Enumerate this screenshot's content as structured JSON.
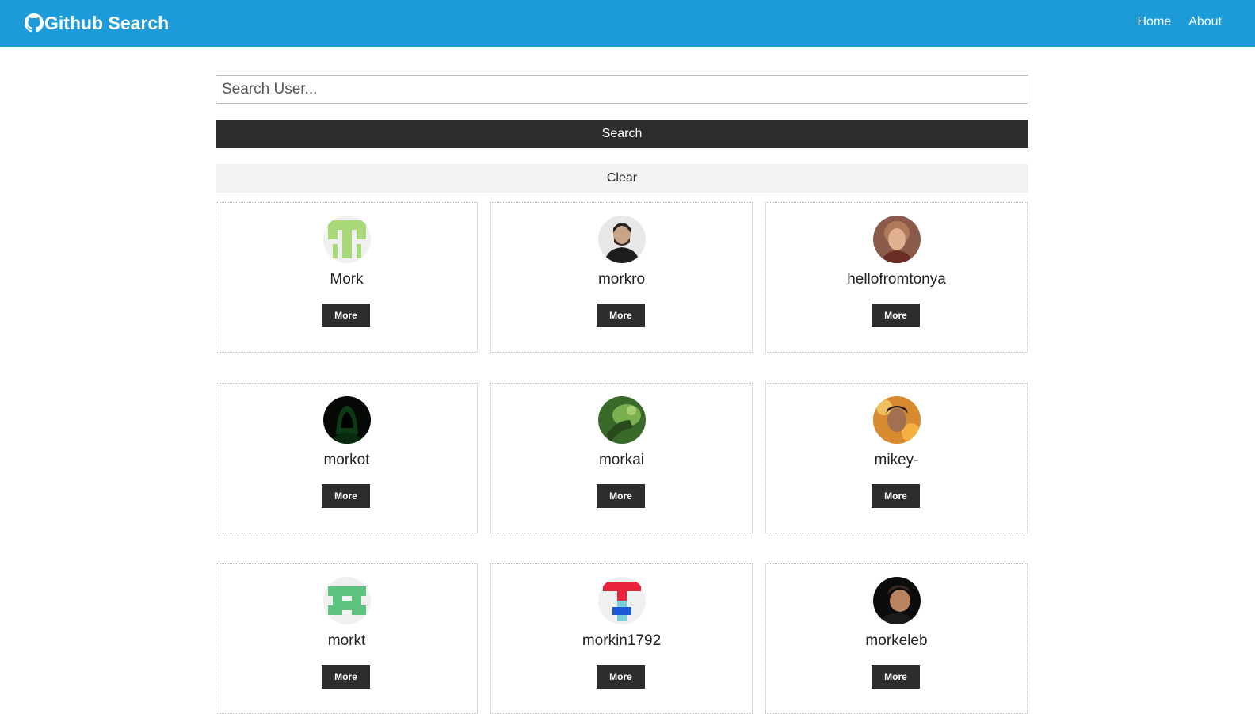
{
  "navbar": {
    "brand": "Github Search",
    "brand_icon": "github-icon",
    "links": [
      "Home",
      "About"
    ],
    "color": "#1c9bd8"
  },
  "search": {
    "placeholder": "Search User...",
    "value": "",
    "button_label": "Search",
    "clear_label": "Clear"
  },
  "users": [
    {
      "login": "Mork",
      "more_label": "More"
    },
    {
      "login": "morkro",
      "more_label": "More"
    },
    {
      "login": "hellofromtonya",
      "more_label": "More"
    },
    {
      "login": "morkot",
      "more_label": "More"
    },
    {
      "login": "morkai",
      "more_label": "More"
    },
    {
      "login": "mikey-",
      "more_label": "More"
    },
    {
      "login": "morkt",
      "more_label": "More"
    },
    {
      "login": "morkin1792",
      "more_label": "More"
    },
    {
      "login": "morkeleb",
      "more_label": "More"
    }
  ]
}
